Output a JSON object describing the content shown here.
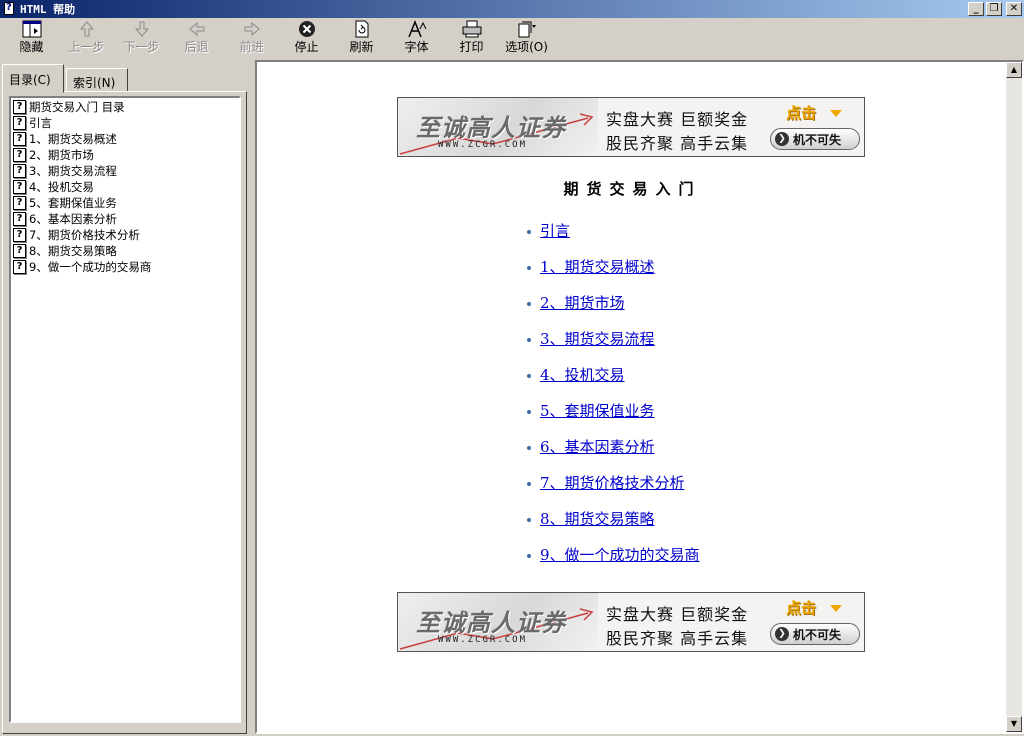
{
  "window": {
    "title": "HTML 帮助",
    "controls": {
      "minimize": "_",
      "restore": "❐",
      "close": "✕"
    }
  },
  "toolbar": {
    "buttons": [
      {
        "label": "隐藏",
        "icon": "hide-pane-icon",
        "enabled": true
      },
      {
        "label": "上一步",
        "icon": "up-arrow-icon",
        "enabled": false
      },
      {
        "label": "下一步",
        "icon": "down-arrow-icon",
        "enabled": false
      },
      {
        "label": "后退",
        "icon": "back-arrow-icon",
        "enabled": false
      },
      {
        "label": "前进",
        "icon": "forward-arrow-icon",
        "enabled": false
      },
      {
        "label": "停止",
        "icon": "stop-icon",
        "enabled": true
      },
      {
        "label": "刷新",
        "icon": "refresh-icon",
        "enabled": true
      },
      {
        "label": "字体",
        "icon": "font-icon",
        "enabled": true
      },
      {
        "label": "打印",
        "icon": "print-icon",
        "enabled": true
      },
      {
        "label": "选项(O)",
        "icon": "options-icon",
        "enabled": true
      }
    ]
  },
  "navigation": {
    "tabs": [
      {
        "label": "目录(C)",
        "active": true
      },
      {
        "label": "索引(N)",
        "active": false
      }
    ],
    "toc_items": [
      "期货交易入门 目录",
      "引言",
      "1、期货交易概述",
      "2、期货市场",
      "3、期货交易流程",
      "4、投机交易",
      "5、套期保值业务",
      "6、基本因素分析",
      "7、期货价格技术分析",
      "8、期货交易策略",
      "9、做一个成功的交易商"
    ],
    "item_icon": "?"
  },
  "content": {
    "banner": {
      "logo": "至诚高人证券",
      "url": "WWW.ZCGR.COM",
      "slogan_line1": "实盘大赛 巨额奖金",
      "slogan_line2": "股民齐聚 高手云集",
      "cta_top": "点击",
      "cta_button": "机不可失"
    },
    "heading": "期货交易入门",
    "links": [
      "引言",
      "1、期货交易概述",
      "2、期货市场",
      "3、期货交易流程",
      "4、投机交易",
      "5、套期保值业务",
      "6、基本因素分析",
      "7、期货价格技术分析",
      "8、期货交易策略",
      "9、做一个成功的交易商"
    ]
  },
  "colors": {
    "titlebar_start": "#0a246a",
    "titlebar_end": "#a6caf0",
    "link": "#0000cc",
    "chrome": "#d4d0c8",
    "cta_gold": "#f0a800"
  }
}
